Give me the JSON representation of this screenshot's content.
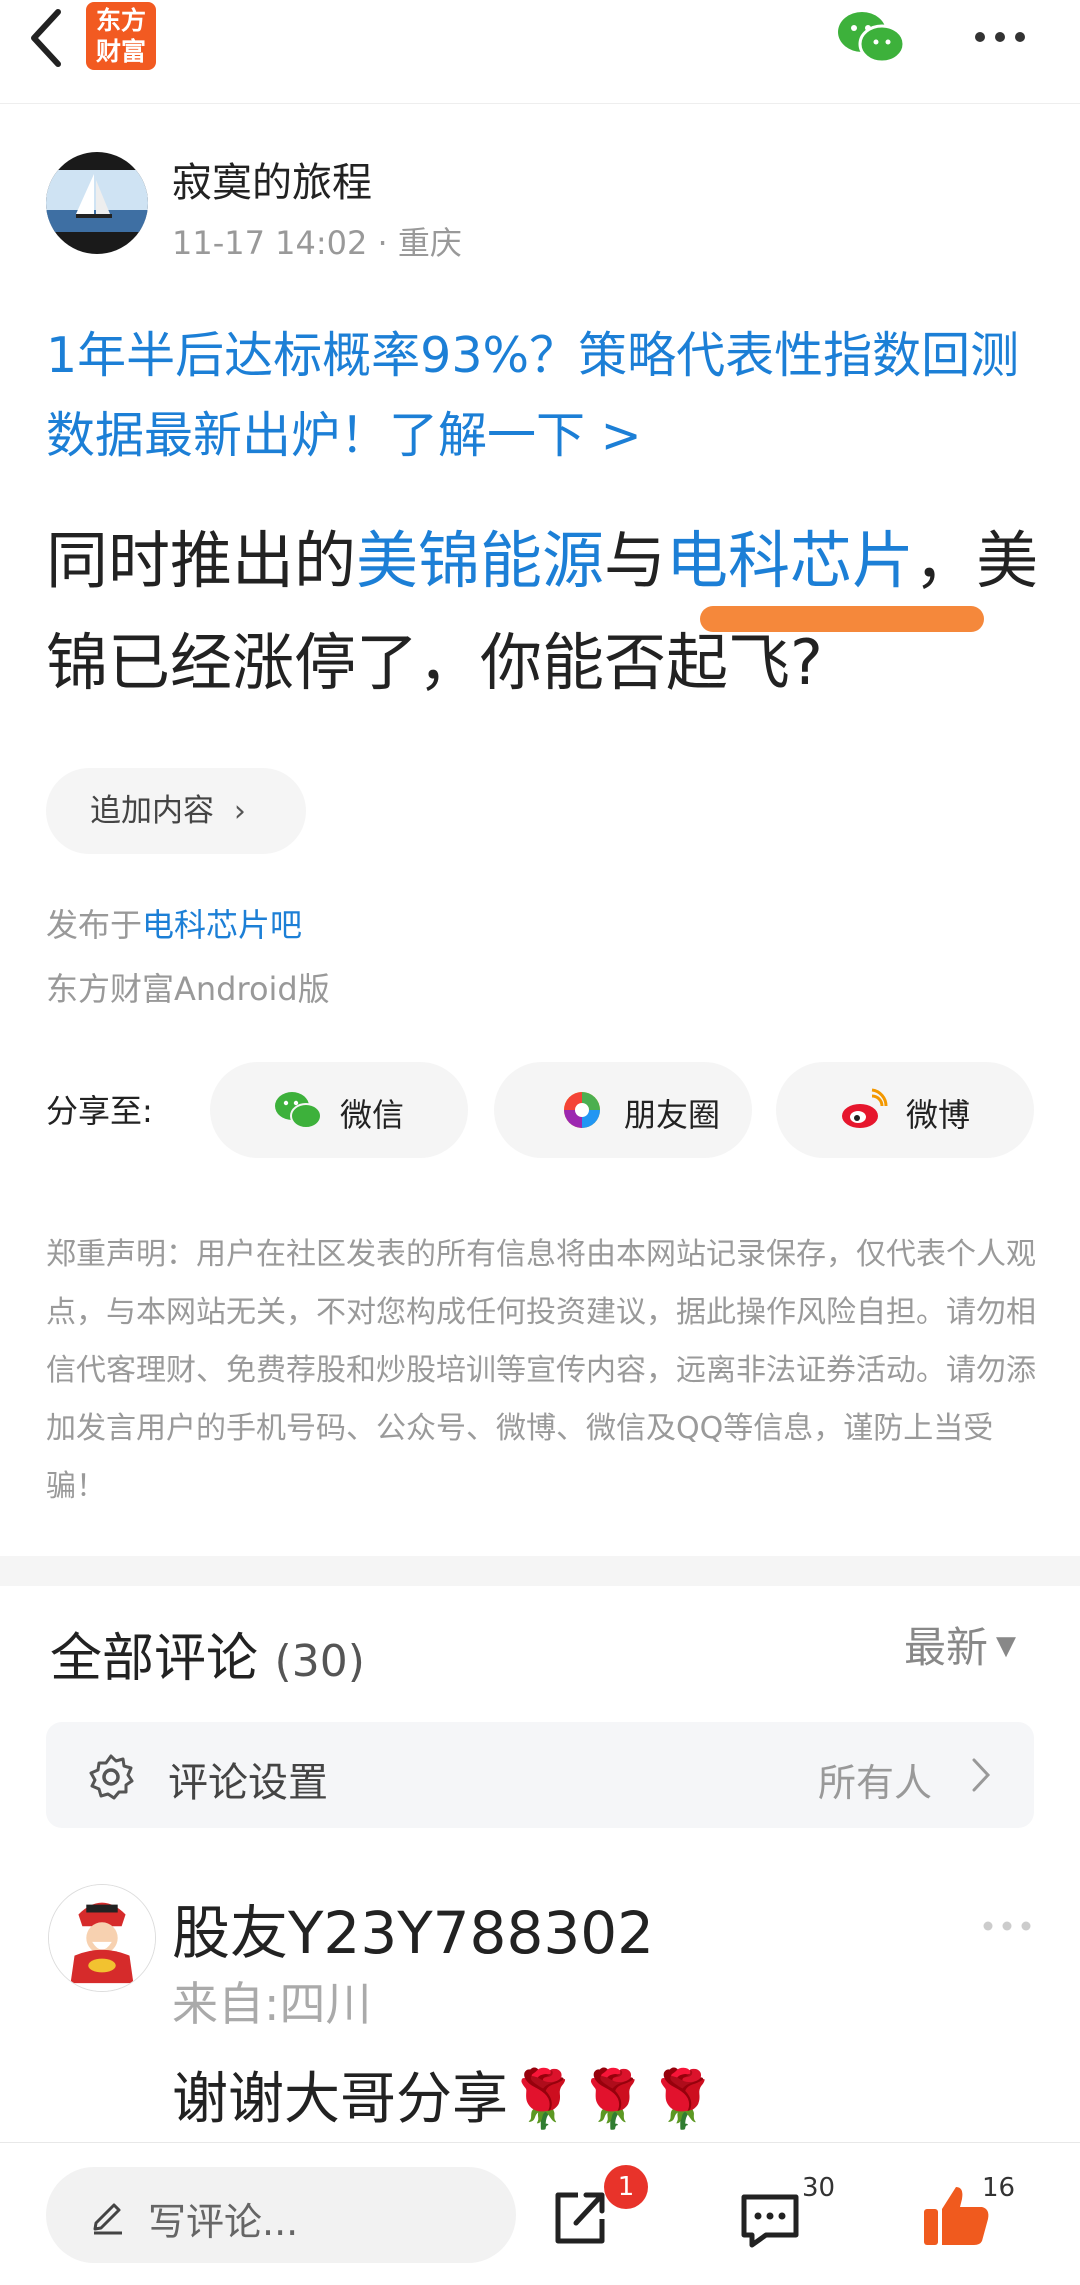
{
  "header": {
    "logo_line1": "东方",
    "logo_line2": "财富",
    "back_icon": "chevron-left-icon",
    "wechat_icon": "wechat-icon",
    "more_icon": "more-horizontal-icon"
  },
  "post": {
    "author": "寂寞的旅程",
    "time": "11-17 14:02",
    "location": "· 重庆",
    "promo": "1年半后达标概率93%？策略代表性指数回测数据最新出炉！了解一下 >",
    "title_part1": "同时推出的",
    "title_link1": "美锦能源",
    "title_part2": "与",
    "title_link2": "电科芯片",
    "title_part3": "，美锦已经涨停了，你能否起飞?",
    "append_label": "追加内容",
    "posted_prefix": "发布于",
    "posted_bar": "电科芯片吧",
    "client": "东方财富Android版"
  },
  "share": {
    "label": "分享至:",
    "buttons": [
      {
        "label": "微信",
        "icon": "wechat-icon"
      },
      {
        "label": "朋友圈",
        "icon": "moments-icon"
      },
      {
        "label": "微博",
        "icon": "weibo-icon"
      }
    ]
  },
  "disclaimer": "郑重声明：用户在社区发表的所有信息将由本网站记录保存，仅代表个人观点，与本网站无关，不对您构成任何投资建议，据此操作风险自担。请勿相信代客理财、免费荐股和炒股培训等宣传内容，远离非法证券活动。请勿添加发言用户的手机号码、公众号、微博、微信及QQ等信息，谨防上当受骗！",
  "comments": {
    "title": "全部评论",
    "count": "(30)",
    "sort_label": "最新",
    "settings_label": "评论设置",
    "settings_value": "所有人",
    "items": [
      {
        "name": "股友Y23Y788302",
        "from": "来自:四川",
        "text": "谢谢大哥分享🌹🌹🌹"
      }
    ]
  },
  "bottom": {
    "compose_placeholder": "写评论...",
    "share_badge": "1",
    "comment_count": "30",
    "like_count": "16"
  },
  "colors": {
    "accent": "#1c7fd6",
    "brand": "#f25a21",
    "highlight": "#f5883b",
    "like": "#f05a1e"
  }
}
